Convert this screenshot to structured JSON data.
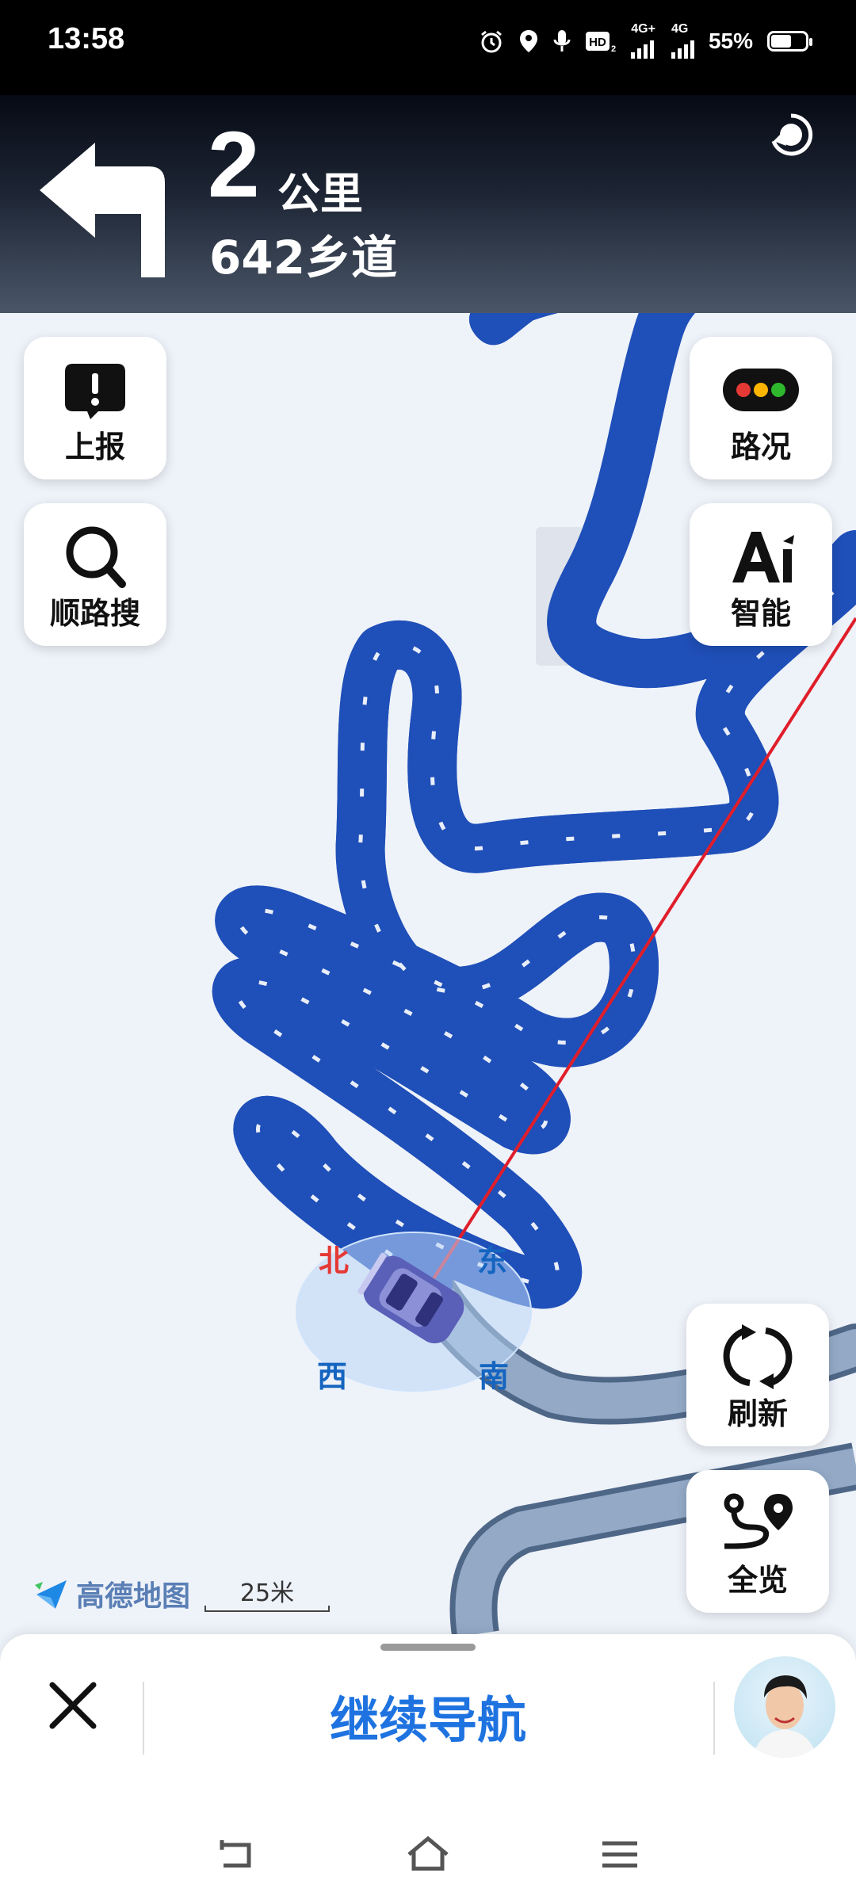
{
  "status_bar": {
    "time": "13:58",
    "network_1": "4G+",
    "network_2": "4G",
    "battery": "55%",
    "battery_level": 0.55
  },
  "nav": {
    "distance_value": "2",
    "distance_unit": "公里",
    "road_name": "642乡道",
    "turn_direction": "left"
  },
  "left_buttons": [
    {
      "label": "上报",
      "icon": "report-icon"
    },
    {
      "label": "顺路搜",
      "icon": "search-icon"
    }
  ],
  "right_buttons": [
    {
      "label": "路况",
      "icon": "traffic-light-icon"
    },
    {
      "label": "智能",
      "icon": "ai-icon"
    },
    {
      "label": "刷新",
      "icon": "refresh-icon"
    },
    {
      "label": "全览",
      "icon": "route-overview-icon"
    }
  ],
  "compass": {
    "north": "北",
    "east": "东",
    "south": "南",
    "west": "西"
  },
  "map": {
    "logo_text": "高德地图",
    "scale_text": "25米",
    "route_color": "#3d7cf0",
    "passed_route_color": "#93a9c6",
    "guide_line_color": "#e01e2b"
  },
  "bottom_bar": {
    "continue_label": "继续导航"
  }
}
